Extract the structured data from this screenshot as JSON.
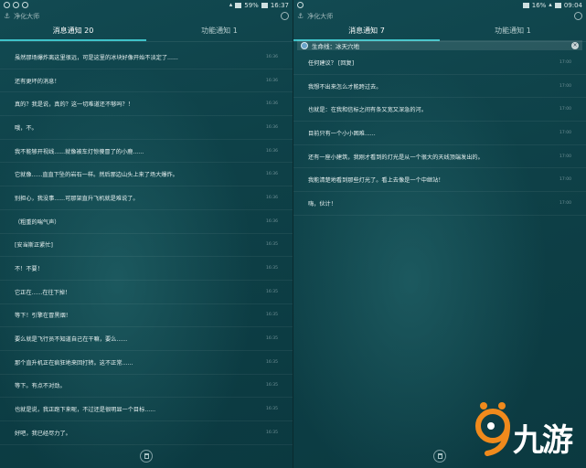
{
  "left": {
    "status": {
      "battery": "59%",
      "time": "16:37"
    },
    "carrier": "净化大师",
    "tabs": [
      {
        "label": "消息通知 20",
        "active": true
      },
      {
        "label": "功能通知 1",
        "active": false
      }
    ],
    "notifications": [
      {
        "text": "虽然那场爆炸离这里很远，可是这里的冰块好像开始不淡定了......",
        "time": "16:36"
      },
      {
        "text": "还有更坏的消息！",
        "time": "16:36"
      },
      {
        "text": "真的？我是说，真的？这一切难道还不够吗？！",
        "time": "16:36"
      },
      {
        "text": "哦，不。",
        "time": "16:36"
      },
      {
        "text": "我不能够开视线......就像被车灯惊傻冒了的小鹿......",
        "time": "16:36"
      },
      {
        "text": "它就像......直直下坠的岩石一样。然后那边山头上来了场大爆炸。",
        "time": "16:36"
      },
      {
        "text": "别担心，我没事......可那架直升飞机就是难说了。",
        "time": "16:36"
      },
      {
        "text": "（粗重的喘气声）",
        "time": "16:36"
      },
      {
        "text": "[安当斯正紧忙]",
        "time": "16:35"
      },
      {
        "text": "不！不要！",
        "time": "16:35"
      },
      {
        "text": "它正在......在往下掉！",
        "time": "16:35"
      },
      {
        "text": "等下！引擎在冒黑烟！",
        "time": "16:35"
      },
      {
        "text": "要么就是飞行员不知道自己在干嘛，要么......",
        "time": "16:35"
      },
      {
        "text": "那个直升机正在疯狂地来回打转。这不正常......",
        "time": "16:35"
      },
      {
        "text": "等下。有点不对劲。",
        "time": "16:35"
      },
      {
        "text": "也就是说，我正跑下来呢，不过还是很明显一个目标......",
        "time": "16:35"
      },
      {
        "text": "好吧，我已经尽力了。",
        "time": "16:35"
      }
    ]
  },
  "right": {
    "status": {
      "battery": "16%",
      "time": "09:04"
    },
    "carrier": "净化大师",
    "tabs": [
      {
        "label": "消息通知 7",
        "active": true
      },
      {
        "label": "功能通知 1",
        "active": false
      }
    ],
    "app_header": "生命线：冰天穴地",
    "notifications": [
      {
        "text": "任何建议？ [回复]",
        "time": "17:00"
      },
      {
        "text": "我想不出来怎么才能跨过去。",
        "time": "17:00"
      },
      {
        "text": "也就是：在我和信标之间有条又宽又深急的河。",
        "time": "17:00"
      },
      {
        "text": "目前只有一个小小困难......",
        "time": "17:00"
      },
      {
        "text": "还有一座小建筑，我刚才看到的灯光是从一个很大的天线顶端发出的。",
        "time": "17:00"
      },
      {
        "text": "我能清楚地看到那些灯光了。看上去像是一个中继站！",
        "time": "17:00"
      },
      {
        "text": "嗨，伙计！",
        "time": "17:00"
      }
    ]
  },
  "watermark": {
    "text": "九游",
    "digit": "9"
  },
  "colors": {
    "accent": "#3ec3c9",
    "background": "#0d3e44",
    "watermark_orange": "#f08a1c"
  }
}
